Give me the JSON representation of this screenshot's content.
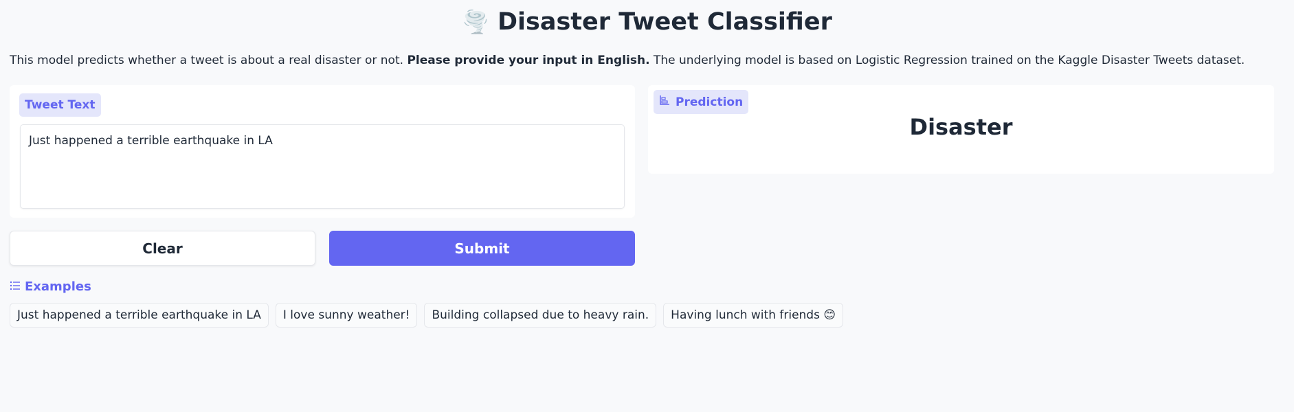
{
  "header": {
    "icon": "tornado-icon",
    "title": "Disaster Tweet Classifier"
  },
  "description": {
    "before": "This model predicts whether a tweet is about a real disaster or not. ",
    "bold": "Please provide your input in English.",
    "after": " The underlying model is based on Logistic Regression trained on the Kaggle Disaster Tweets dataset."
  },
  "input": {
    "label": "Tweet Text",
    "value": "Just happened a terrible earthquake in LA"
  },
  "output": {
    "label": "Prediction",
    "icon": "bar-chart-icon",
    "value": "Disaster"
  },
  "buttons": {
    "clear": "Clear",
    "submit": "Submit"
  },
  "examples": {
    "label": "Examples",
    "icon": "list-icon",
    "items": [
      "Just happened a terrible earthquake in LA",
      "I love sunny weather!",
      "Building collapsed due to heavy rain.",
      "Having lunch with friends 😊"
    ]
  },
  "colors": {
    "accent": "#6366f1",
    "chip_bg": "#e4e6fb",
    "background": "#f8f9fb"
  }
}
